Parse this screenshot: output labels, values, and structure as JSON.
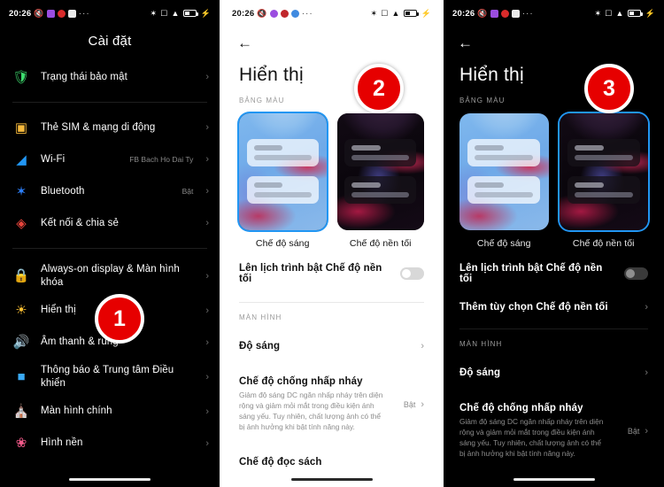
{
  "statusbar": {
    "time": "20:26",
    "left_icons": [
      "no-sound-icon",
      "app-purple-icon",
      "app-red-icon",
      "app-google-icon",
      "overflow-dots-icon"
    ],
    "right_icons": [
      "bluetooth-icon",
      "screenshot-icon",
      "wifi-icon",
      "battery-icon",
      "charging-bolt-icon"
    ],
    "overflow": "···"
  },
  "panel1": {
    "title": "Cài đặt",
    "items": [
      {
        "icon": "shield-check-icon",
        "glyph": "🛡",
        "color": "#3ddc6e",
        "label": "Trạng thái bảo mật",
        "value": ""
      },
      {
        "icon": "sim-card-icon",
        "glyph": "▢",
        "color": "#f5b93c",
        "label": "Thẻ SIM & mạng di động",
        "value": ""
      },
      {
        "icon": "wifi-icon",
        "glyph": "▲",
        "color": "#2196f3",
        "label": "Wi-Fi",
        "value": "FB Bach Ho Dai Ty"
      },
      {
        "icon": "bluetooth-icon",
        "glyph": "✶",
        "color": "#2d7ff9",
        "label": "Bluetooth",
        "value": "Bật"
      },
      {
        "icon": "connection-share-icon",
        "glyph": "◈",
        "color": "#e8453c",
        "label": "Kết nối & chia sẻ",
        "value": ""
      },
      {
        "icon": "lock-icon",
        "glyph": "▬",
        "color": "#f07a6e",
        "label": "Always-on display & Màn hình khóa",
        "value": ""
      },
      {
        "icon": "brightness-icon",
        "glyph": "☀",
        "color": "#ffc233",
        "label": "Hiển thị",
        "value": ""
      },
      {
        "icon": "speaker-icon",
        "glyph": "🔊",
        "color": "#3ddc6e",
        "label": "Âm thanh & rung",
        "value": ""
      },
      {
        "icon": "notification-icon",
        "glyph": "■",
        "color": "#3aaaf5",
        "label": "Thông báo & Trung tâm Điều khiển",
        "value": ""
      },
      {
        "icon": "home-screen-icon",
        "glyph": "⌂",
        "color": "#a26bf0",
        "label": "Màn hình chính",
        "value": ""
      },
      {
        "icon": "wallpaper-icon",
        "glyph": "❀",
        "color": "#f25a8a",
        "label": "Hình nền",
        "value": ""
      }
    ],
    "chevron": "›"
  },
  "panel2": {
    "back_icon": "back-arrow-icon",
    "back_glyph": "←",
    "title": "Hiển thị",
    "section_color_scheme": "BẢNG MÀU",
    "themes": [
      {
        "label": "Chế độ sáng",
        "selected": true
      },
      {
        "label": "Chế độ nền tối",
        "selected": false
      }
    ],
    "schedule_label": "Lên lịch trình bật Chế độ nền tối",
    "schedule_enabled": false,
    "section_screen": "MÀN HÌNH",
    "settings": [
      {
        "name": "Độ sáng",
        "desc": "",
        "value": ""
      },
      {
        "name": "Chế độ chống nhấp nháy",
        "desc": "Giảm độ sáng DC ngăn nhấp nháy trên diện rộng và giảm mỏi mắt trong điều kiện ánh sáng yếu. Tuy nhiên, chất lượng ảnh có thể bị ảnh hưởng khi bật tính năng này.",
        "value": "Bật"
      },
      {
        "name": "Chế độ đọc sách",
        "desc": "",
        "value": ""
      }
    ],
    "chevron": "›"
  },
  "panel3": {
    "back_icon": "back-arrow-icon",
    "back_glyph": "←",
    "title": "Hiển thị",
    "section_color_scheme": "BẢNG MÀU",
    "themes": [
      {
        "label": "Chế độ sáng",
        "selected": false
      },
      {
        "label": "Chế độ nền tối",
        "selected": true
      }
    ],
    "schedule_label": "Lên lịch trình bật Chế độ nền tối",
    "schedule_enabled": false,
    "more_options_label": "Thêm tùy chọn Chế độ nền tối",
    "section_screen": "MÀN HÌNH",
    "settings": [
      {
        "name": "Độ sáng",
        "desc": "",
        "value": ""
      },
      {
        "name": "Chế độ chống nhấp nháy",
        "desc": "Giảm độ sáng DC ngăn nhấp nháy trên diện rộng và giảm mỏi mắt trong điều kiện ánh sáng yếu. Tuy nhiên, chất lượng ảnh có thể bị ảnh hưởng khi bật tính năng này.",
        "value": "Bật"
      }
    ],
    "chevron": "›"
  },
  "badges": {
    "one": "1",
    "two": "2",
    "three": "3",
    "color": "#e60000"
  }
}
